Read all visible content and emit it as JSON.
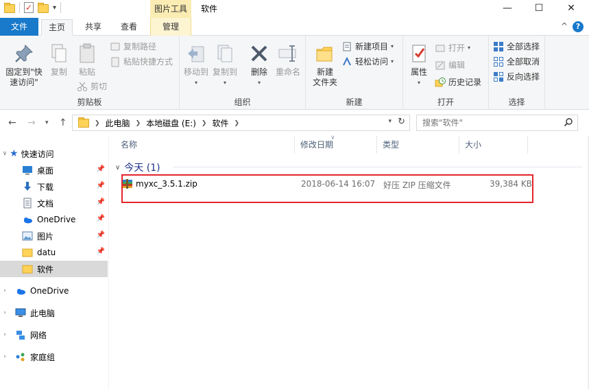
{
  "title_bar": {
    "context_tab": "图片工具",
    "title": "软件",
    "minimize": "—",
    "maximize": "☐",
    "close": "✕"
  },
  "tabs": {
    "file": "文件",
    "home": "主页",
    "share": "共享",
    "view": "查看",
    "manage": "管理",
    "collapse": "^",
    "help": "?"
  },
  "ribbon": {
    "clipboard": {
      "label": "剪贴板",
      "pin_quick_access": "固定到\"快\n速访问\"",
      "copy": "复制",
      "paste": "粘贴",
      "copy_path": "复制路径",
      "paste_shortcut": "粘贴快捷方式",
      "cut": "剪切"
    },
    "organize": {
      "label": "组织",
      "move_to": "移动到",
      "copy_to": "复制到",
      "delete": "删除",
      "rename": "重命名"
    },
    "new": {
      "label": "新建",
      "new_folder": "新建\n文件夹",
      "new_item": "新建项目",
      "easy_access": "轻松访问"
    },
    "open": {
      "label": "打开",
      "properties": "属性",
      "open": "打开",
      "edit": "编辑",
      "history": "历史记录"
    },
    "select": {
      "label": "选择",
      "select_all": "全部选择",
      "select_none": "全部取消",
      "invert": "反向选择"
    }
  },
  "address": {
    "crumbs": [
      "此电脑",
      "本地磁盘 (E:)",
      "软件"
    ],
    "search_placeholder": "搜索\"软件\""
  },
  "nav_pane": {
    "quick_access": "快速访问",
    "items": [
      "桌面",
      "下载",
      "文档",
      "OneDrive",
      "图片",
      "datu",
      "软件"
    ],
    "onedrive": "OneDrive",
    "this_pc": "此电脑",
    "network": "网络",
    "homegroup": "家庭组"
  },
  "columns": {
    "name": "名称",
    "modified": "修改日期",
    "type": "类型",
    "size": "大小"
  },
  "groups": {
    "today": "今天 (1)"
  },
  "files": [
    {
      "name": "myxc_3.5.1.zip",
      "modified": "2018-06-14 16:07",
      "type": "好压 ZIP 压缩文件",
      "size": "39,384 KB"
    }
  ],
  "colors": {
    "file_tab": "#1979ca",
    "context_tab": "#fbecb3",
    "highlight": "#e3242b",
    "group_header": "#1e3287"
  }
}
